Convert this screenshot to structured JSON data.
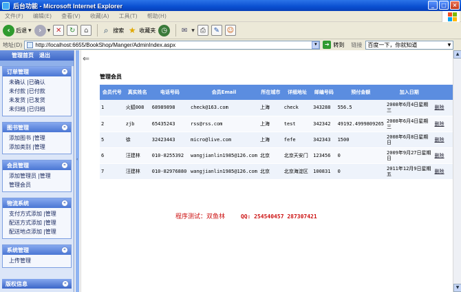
{
  "window": {
    "title": "后台功能 - Microsoft Internet Explorer",
    "controls": [
      "_",
      "□",
      "×"
    ]
  },
  "menu": [
    "文件(F)",
    "编辑(E)",
    "查看(V)",
    "收藏(A)",
    "工具(T)",
    "帮助(H)"
  ],
  "toolbar": {
    "back": "后退",
    "search": "搜索",
    "favorites": "收藏夹"
  },
  "address": {
    "label": "地址(D)",
    "url": "http://localhost:6655/BookShop/Manger/AdminIndex.aspx",
    "go": "转到",
    "links": "链接",
    "search_placeholder": "百度一下，你就知道"
  },
  "nav": {
    "top_links": [
      "管理首页",
      "退出"
    ],
    "sections": [
      {
        "title": "订单管理",
        "rows": [
          [
            "未确认",
            "已确认"
          ],
          [
            "未付款",
            "已付款"
          ],
          [
            "未发货",
            "已发货"
          ],
          [
            "未归档",
            "已归档"
          ]
        ]
      },
      {
        "title": "图书管理",
        "rows": [
          [
            "添加图书",
            "管理"
          ],
          [
            "添加类别",
            "管理"
          ]
        ]
      },
      {
        "title": "会员管理",
        "rows": [
          [
            "添加管理员",
            "管理"
          ],
          [
            "管理会员"
          ]
        ]
      },
      {
        "title": "物流系统",
        "rows": [
          [
            "支付方式添加",
            "管理"
          ],
          [
            "配送方式添加",
            "管理"
          ],
          [
            "配送地点添加",
            "管理"
          ]
        ]
      },
      {
        "title": "系统管理",
        "rows": [
          [
            "上传管理"
          ]
        ]
      }
    ],
    "copyright": "版权信息"
  },
  "main": {
    "heading": "管理会员",
    "columns": [
      "会员代号",
      "真实姓名",
      "电话号码",
      "会员Email",
      "所在城市",
      "详细地址",
      "邮编号码",
      "预付金额",
      "加入日期",
      ""
    ],
    "rows": [
      [
        "1",
        "火狐008",
        "68989898",
        "check@163.com",
        "上海",
        "check",
        "343288",
        "556.5",
        "2008年6月4日星期三",
        "删除"
      ],
      [
        "2",
        "zjb",
        "65435243",
        "rss@rss.com",
        "上海",
        "test",
        "342342",
        "49192.4999809265",
        "2008年6月4日星期三",
        "删除"
      ],
      [
        "5",
        "徐",
        "32423443",
        "micro@live.com",
        "上海",
        "fefe",
        "342343",
        "1500",
        "2008年6月8日星期日",
        "删除"
      ],
      [
        "6",
        "汪建林",
        "010-8255392",
        "wangjianlin1985@126.com",
        "北京",
        "北京天安门",
        "123456",
        "0",
        "2009年9月27日星期日",
        "删除"
      ],
      [
        "7",
        "汪建林",
        "010-82976880",
        "wangjianlin1985@126.com",
        "北京",
        "北京海淀区",
        "100831",
        "0",
        "2011年12月9日星期五",
        "删除"
      ]
    ]
  },
  "footer": {
    "program_test": "程序测试：双鱼林",
    "qq": "QQ: 254540457 287307421"
  }
}
